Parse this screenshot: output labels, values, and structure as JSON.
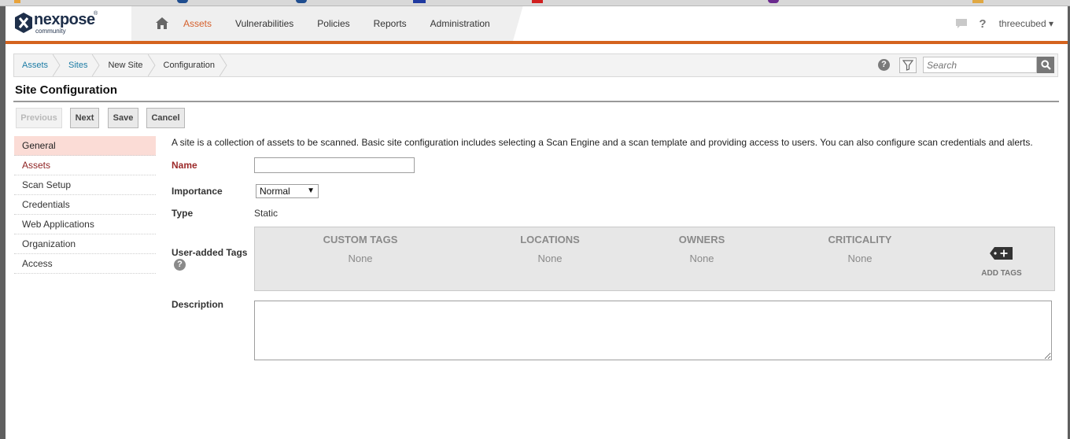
{
  "brand": {
    "name": "nexpose",
    "edition": "community",
    "registered_mark": "®"
  },
  "nav": {
    "items": [
      {
        "label": "Assets",
        "active": true
      },
      {
        "label": "Vulnerabilities",
        "active": false
      },
      {
        "label": "Policies",
        "active": false
      },
      {
        "label": "Reports",
        "active": false
      },
      {
        "label": "Administration",
        "active": false
      }
    ]
  },
  "header": {
    "help_label": "?",
    "user_label": "threecubed ▾"
  },
  "breadcrumb": [
    "Assets",
    "Sites",
    "New Site",
    "Configuration"
  ],
  "search": {
    "placeholder": "Search"
  },
  "page": {
    "title": "Site Configuration"
  },
  "buttons": {
    "previous": "Previous",
    "next": "Next",
    "save": "Save",
    "cancel": "Cancel"
  },
  "sidebar": {
    "items": [
      "General",
      "Assets",
      "Scan Setup",
      "Credentials",
      "Web Applications",
      "Organization",
      "Access"
    ]
  },
  "form": {
    "intro": "A site is a collection of assets to be scanned. Basic site configuration includes selecting a Scan Engine and a scan template and providing access to users. You can also configure scan credentials and alerts.",
    "name_label": "Name",
    "name_value": "",
    "importance_label": "Importance",
    "importance_value": "Normal",
    "type_label": "Type",
    "type_value": "Static",
    "tags_label": "User-added Tags",
    "tags_help": "?",
    "description_label": "Description",
    "description_value": ""
  },
  "tags": {
    "columns": [
      {
        "header": "CUSTOM TAGS",
        "value": "None"
      },
      {
        "header": "LOCATIONS",
        "value": "None"
      },
      {
        "header": "OWNERS",
        "value": "None"
      },
      {
        "header": "CRITICALITY",
        "value": "None"
      }
    ],
    "add_label": "ADD TAGS"
  },
  "colors": {
    "accent": "#d4631e",
    "active_nav": "#d5602c",
    "link": "#1c7ca5",
    "sidebar_active_bg": "#fbdcd6",
    "required_label": "#9c2a2a"
  }
}
